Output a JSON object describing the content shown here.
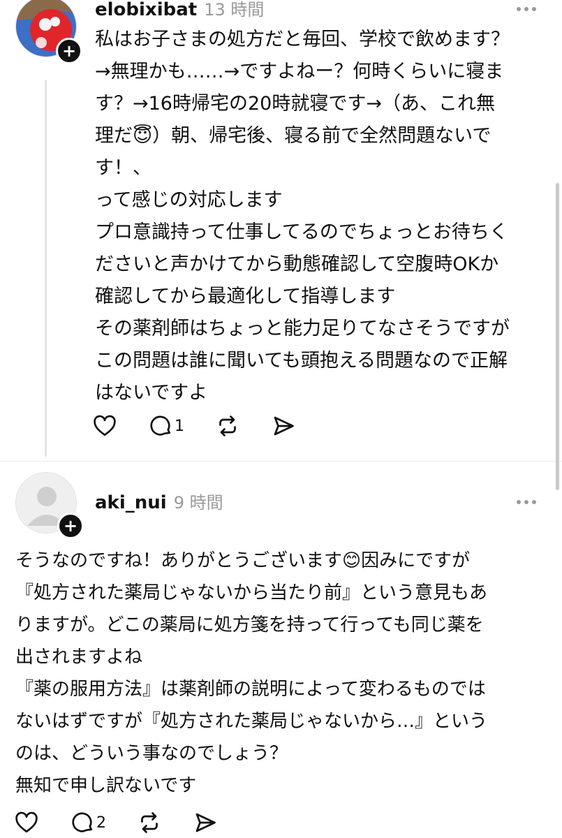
{
  "posts": [
    {
      "username": "elobixibat",
      "timestamp": "13 時間",
      "lines": [
        "私はお子さまの処方だと毎回、学校で飲めます？",
        "→無理かも……→ですよねー？何時くらいに寝ま",
        "す？→16時帰宅の20時就寝です→（あ、これ無",
        "理だ😇）朝、帰宅後、寝る前で全然問題ないで",
        "す！、",
        "って感じの対応します",
        "プロ意識持って仕事してるのでちょっとお待ちく",
        "ださいと声かけてから動態確認して空腹時OKか",
        "確認してから最適化して指導します",
        "その薬剤師はちょっと能力足りてなさそうですが",
        "この問題は誰に聞いても頭抱える問題なので正解",
        "はないですよ"
      ],
      "reply_count": "1"
    },
    {
      "username": "aki_nui",
      "timestamp": "9 時間",
      "lines": [
        "そうなのですね！ありがとうございます😊因みにですが",
        "『処方された薬局じゃないから当たり前』という意見もあ",
        "りますが。どこの薬局に処方箋を持って行っても同じ薬を",
        "出されますよね",
        "『薬の服用方法』は薬剤師の説明によって変わるものでは",
        "ないはずですが『処方された薬局じゃないから…』という",
        "のは、どういう事なのでしょう？",
        "無知で申し訳ないです"
      ],
      "reply_count": "2"
    }
  ],
  "icons": {
    "like": "heart-icon",
    "reply": "speech-bubble-icon",
    "repost": "repost-icon",
    "share": "send-icon",
    "more": "more-horizontal-icon",
    "follow": "plus-icon"
  },
  "colors": {
    "text": "#111111",
    "muted": "#999999",
    "line": "#e3e3e3",
    "avatar_red": "#e0262b",
    "avatar_blue": "#3d6fc4",
    "avatar_gray": "#d9d9d9"
  }
}
